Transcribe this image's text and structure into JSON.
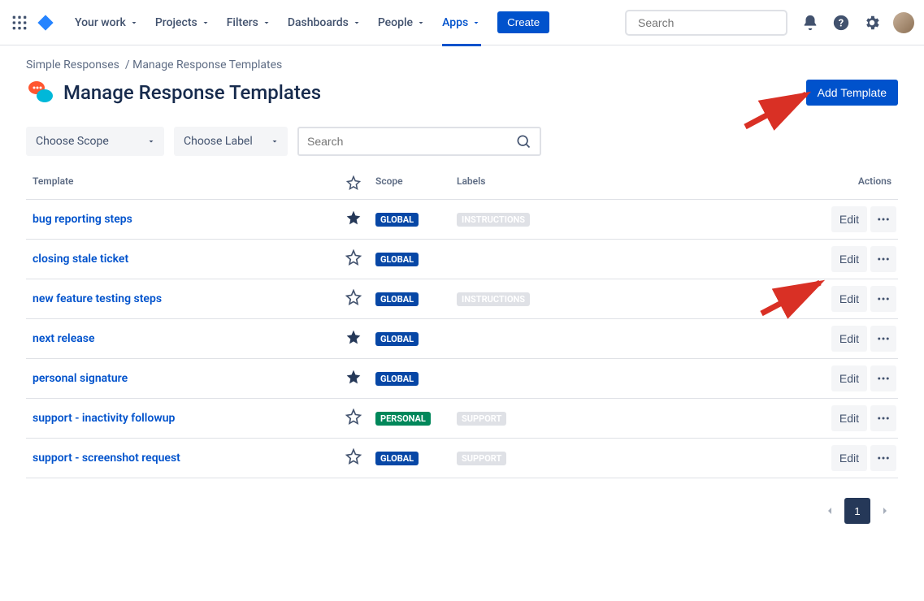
{
  "nav": {
    "items": [
      {
        "label": "Your work",
        "active": false
      },
      {
        "label": "Projects",
        "active": false
      },
      {
        "label": "Filters",
        "active": false
      },
      {
        "label": "Dashboards",
        "active": false
      },
      {
        "label": "People",
        "active": false
      },
      {
        "label": "Apps",
        "active": true
      }
    ],
    "create": "Create",
    "search_placeholder": "Search"
  },
  "breadcrumb": {
    "root": "Simple Responses",
    "current": "Manage Response Templates"
  },
  "page": {
    "title": "Manage Response Templates",
    "add_button": "Add Template"
  },
  "filters": {
    "scope_placeholder": "Choose Scope",
    "label_placeholder": "Choose Label",
    "search_placeholder": "Search"
  },
  "table": {
    "headers": {
      "template": "Template",
      "scope": "Scope",
      "labels": "Labels",
      "actions": "Actions"
    },
    "edit_label": "Edit",
    "rows": [
      {
        "name": "bug reporting steps",
        "starred": true,
        "scope": "GLOBAL",
        "labels": [
          "INSTRUCTIONS"
        ]
      },
      {
        "name": "closing stale ticket",
        "starred": false,
        "scope": "GLOBAL",
        "labels": []
      },
      {
        "name": "new feature testing steps",
        "starred": false,
        "scope": "GLOBAL",
        "labels": [
          "INSTRUCTIONS"
        ]
      },
      {
        "name": "next release",
        "starred": true,
        "scope": "GLOBAL",
        "labels": []
      },
      {
        "name": "personal signature",
        "starred": true,
        "scope": "GLOBAL",
        "labels": []
      },
      {
        "name": "support - inactivity followup",
        "starred": false,
        "scope": "PERSONAL",
        "labels": [
          "SUPPORT"
        ]
      },
      {
        "name": "support - screenshot request",
        "starred": false,
        "scope": "GLOBAL",
        "labels": [
          "SUPPORT"
        ]
      }
    ]
  },
  "pagination": {
    "current": "1"
  }
}
